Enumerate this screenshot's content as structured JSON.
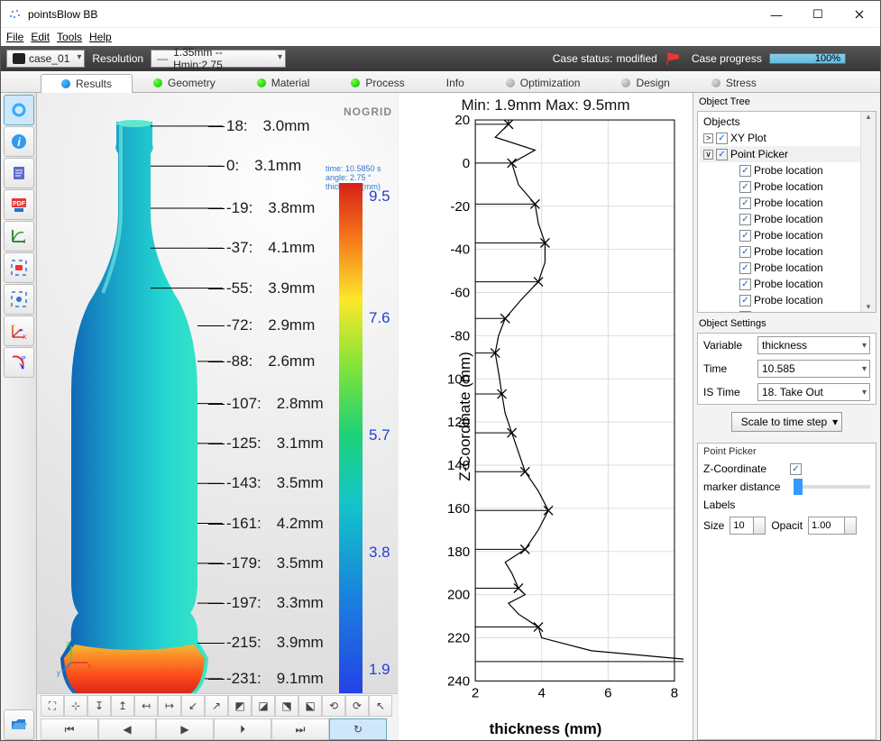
{
  "window": {
    "title": "pointsBlow BB"
  },
  "menu": [
    "File",
    "Edit",
    "Tools",
    "Help"
  ],
  "toolbar": {
    "case": "case_01",
    "resolution_label": "Resolution",
    "resolution_value": "1.35mm -- Hmin:2.75",
    "status_label": "Case status:",
    "status_value": "modified",
    "progress_label": "Case progress",
    "progress_value": "100%"
  },
  "tabs": [
    {
      "label": "Results",
      "dot": "blue",
      "active": true
    },
    {
      "label": "Geometry",
      "dot": "green"
    },
    {
      "label": "Material",
      "dot": "green"
    },
    {
      "label": "Process",
      "dot": "green"
    },
    {
      "label": "Info",
      "dot": ""
    },
    {
      "label": "Optimization",
      "dot": "grey"
    },
    {
      "label": "Design",
      "dot": "grey"
    },
    {
      "label": "Stress",
      "dot": "grey"
    }
  ],
  "viz": {
    "logo_a": "NO",
    "logo_b": "GRID",
    "meta": "time: 10.5850 s\nangle: 2.75 °\nthickness (mm)",
    "scale_vals": [
      "9.5",
      "7.6",
      "5.7",
      "3.8",
      "1.9"
    ],
    "readings": [
      {
        "z": 18,
        "val": "3.0mm"
      },
      {
        "z": 0,
        "val": "3.1mm"
      },
      {
        "z": -19,
        "val": "3.8mm"
      },
      {
        "z": -37,
        "val": "4.1mm"
      },
      {
        "z": -55,
        "val": "3.9mm"
      },
      {
        "z": -72,
        "val": "2.9mm"
      },
      {
        "z": -88,
        "val": "2.6mm"
      },
      {
        "z": -107,
        "val": "2.8mm"
      },
      {
        "z": -125,
        "val": "3.1mm"
      },
      {
        "z": -143,
        "val": "3.5mm"
      },
      {
        "z": -161,
        "val": "4.2mm"
      },
      {
        "z": -179,
        "val": "3.5mm"
      },
      {
        "z": -197,
        "val": "3.3mm"
      },
      {
        "z": -215,
        "val": "3.9mm"
      },
      {
        "z": -231,
        "val": "9.1mm"
      }
    ]
  },
  "chart_data": {
    "type": "line",
    "title": "Min: 1.9mm Max: 9.5mm",
    "xlabel": "thickness (mm)",
    "ylabel": "Z-Coordinate (mm)",
    "xlim": [
      2,
      8
    ],
    "ylim": [
      -240,
      20
    ],
    "xticks": [
      2,
      4,
      6,
      8
    ],
    "yticks": [
      20,
      0,
      -20,
      -40,
      -60,
      -80,
      -100,
      -120,
      -140,
      -160,
      -180,
      -200,
      -220,
      -240
    ],
    "markers": [
      {
        "z": 18,
        "t": 3.0
      },
      {
        "z": 0,
        "t": 3.1
      },
      {
        "z": -19,
        "t": 3.8
      },
      {
        "z": -37,
        "t": 4.1
      },
      {
        "z": -55,
        "t": 3.9
      },
      {
        "z": -72,
        "t": 2.9
      },
      {
        "z": -88,
        "t": 2.6
      },
      {
        "z": -107,
        "t": 2.8
      },
      {
        "z": -125,
        "t": 3.1
      },
      {
        "z": -143,
        "t": 3.5
      },
      {
        "z": -161,
        "t": 4.2
      },
      {
        "z": -179,
        "t": 3.5
      },
      {
        "z": -197,
        "t": 3.3
      },
      {
        "z": -215,
        "t": 3.9
      },
      {
        "z": -231,
        "t": 9.1
      }
    ],
    "curve": [
      {
        "z": 20,
        "t": 3.0
      },
      {
        "z": 18,
        "t": 3.0
      },
      {
        "z": 12,
        "t": 2.6
      },
      {
        "z": 6,
        "t": 3.8
      },
      {
        "z": 0,
        "t": 3.1
      },
      {
        "z": -10,
        "t": 3.3
      },
      {
        "z": -19,
        "t": 3.8
      },
      {
        "z": -28,
        "t": 3.9
      },
      {
        "z": -37,
        "t": 4.1
      },
      {
        "z": -46,
        "t": 4.1
      },
      {
        "z": -55,
        "t": 3.9
      },
      {
        "z": -63,
        "t": 3.4
      },
      {
        "z": -72,
        "t": 2.9
      },
      {
        "z": -80,
        "t": 2.7
      },
      {
        "z": -88,
        "t": 2.6
      },
      {
        "z": -97,
        "t": 2.7
      },
      {
        "z": -107,
        "t": 2.8
      },
      {
        "z": -116,
        "t": 2.9
      },
      {
        "z": -125,
        "t": 3.1
      },
      {
        "z": -134,
        "t": 3.3
      },
      {
        "z": -143,
        "t": 3.5
      },
      {
        "z": -152,
        "t": 3.9
      },
      {
        "z": -161,
        "t": 4.2
      },
      {
        "z": -170,
        "t": 3.9
      },
      {
        "z": -179,
        "t": 3.5
      },
      {
        "z": -185,
        "t": 2.9
      },
      {
        "z": -190,
        "t": 3.1
      },
      {
        "z": -197,
        "t": 3.3
      },
      {
        "z": -200,
        "t": 3.5
      },
      {
        "z": -204,
        "t": 3.0
      },
      {
        "z": -209,
        "t": 3.3
      },
      {
        "z": -215,
        "t": 3.9
      },
      {
        "z": -220,
        "t": 4.0
      },
      {
        "z": -226,
        "t": 5.5
      },
      {
        "z": -231,
        "t": 9.1
      },
      {
        "z": -232,
        "t": 8.4
      }
    ]
  },
  "tree": {
    "head": "Object Tree",
    "root": "Objects",
    "items": [
      {
        "label": "XY Plot",
        "indent": 1
      },
      {
        "label": "Point Picker",
        "indent": 1,
        "sel": true,
        "exp": true
      },
      {
        "label": "Probe location",
        "indent": 2
      },
      {
        "label": "Probe location",
        "indent": 2
      },
      {
        "label": "Probe location",
        "indent": 2
      },
      {
        "label": "Probe location",
        "indent": 2
      },
      {
        "label": "Probe location",
        "indent": 2
      },
      {
        "label": "Probe location",
        "indent": 2
      },
      {
        "label": "Probe location",
        "indent": 2
      },
      {
        "label": "Probe location",
        "indent": 2
      },
      {
        "label": "Probe location",
        "indent": 2
      },
      {
        "label": "Probe location",
        "indent": 2
      }
    ]
  },
  "settings": {
    "head": "Object Settings",
    "variable_label": "Variable",
    "variable": "thickness",
    "time_label": "Time",
    "time": "10.585",
    "istime_label": "IS Time",
    "istime": "18. Take Out",
    "scale_btn": "Scale to time step"
  },
  "pp": {
    "head": "Point Picker",
    "zcoord": "Z-Coordinate",
    "marker": "marker distance",
    "labels": "Labels",
    "size_label": "Size",
    "size": "10",
    "opac_label": "Opacit",
    "opac": "1.00"
  }
}
